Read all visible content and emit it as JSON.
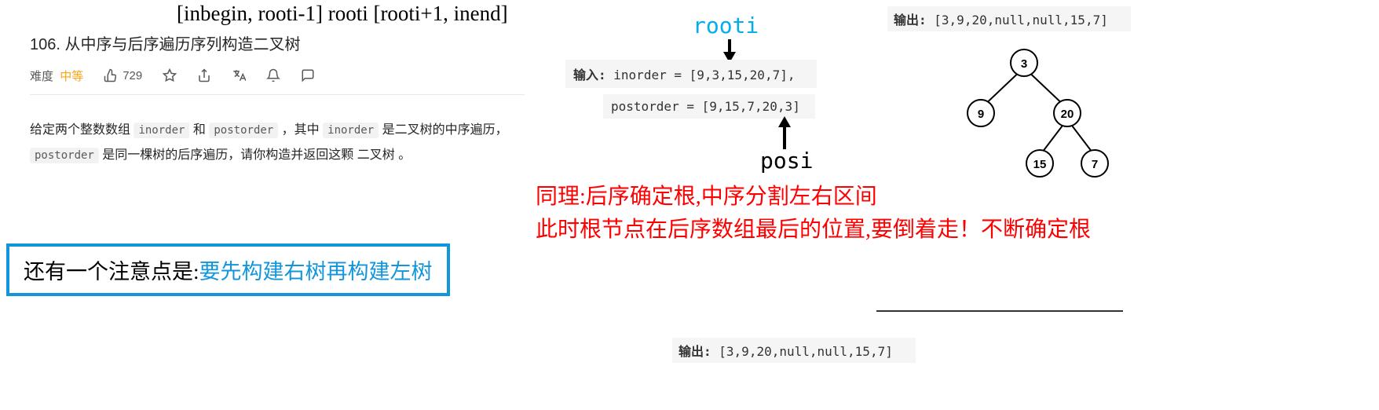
{
  "formula": "[inbegin, rooti-1]  rooti  [rooti+1, inend]",
  "title": "106. 从中序与后序遍历序列构造二叉树",
  "meta": {
    "difficulty_label": "难度",
    "difficulty_value": "中等",
    "likes": "729"
  },
  "description": {
    "prefix": "给定两个整数数组 ",
    "code1": "inorder",
    "mid1": " 和 ",
    "code2": "postorder",
    "mid2": " ，其中 ",
    "code3": "inorder",
    "mid3": " 是二叉树的中序遍历， ",
    "code4": "postorder",
    "suffix": " 是同一棵树的后序遍历，请你构造并返回这颗 二叉树 。"
  },
  "note": {
    "black": "还有一个注意点是:",
    "blue": "要先构建右树再构建左树"
  },
  "rooti_label": "rooti",
  "input": {
    "label": "输入: ",
    "inorder": "inorder = [9,3,15,20,7],",
    "postorder": "postorder = [9,15,7,20,3]"
  },
  "posi_label": "posi",
  "explain": {
    "line1": "同理:后序确定根,中序分割左右区间",
    "line2": "此时根节点在后序数组最后的位置,要倒着走！不断确定根"
  },
  "output": {
    "label": "输出: ",
    "value": "[3,9,20,null,null,15,7]"
  },
  "tree": {
    "root": "3",
    "left": "9",
    "right": "20",
    "right_left": "15",
    "right_right": "7"
  },
  "output2": {
    "label": "输出: ",
    "value": "[3,9,20,null,null,15,7]"
  }
}
